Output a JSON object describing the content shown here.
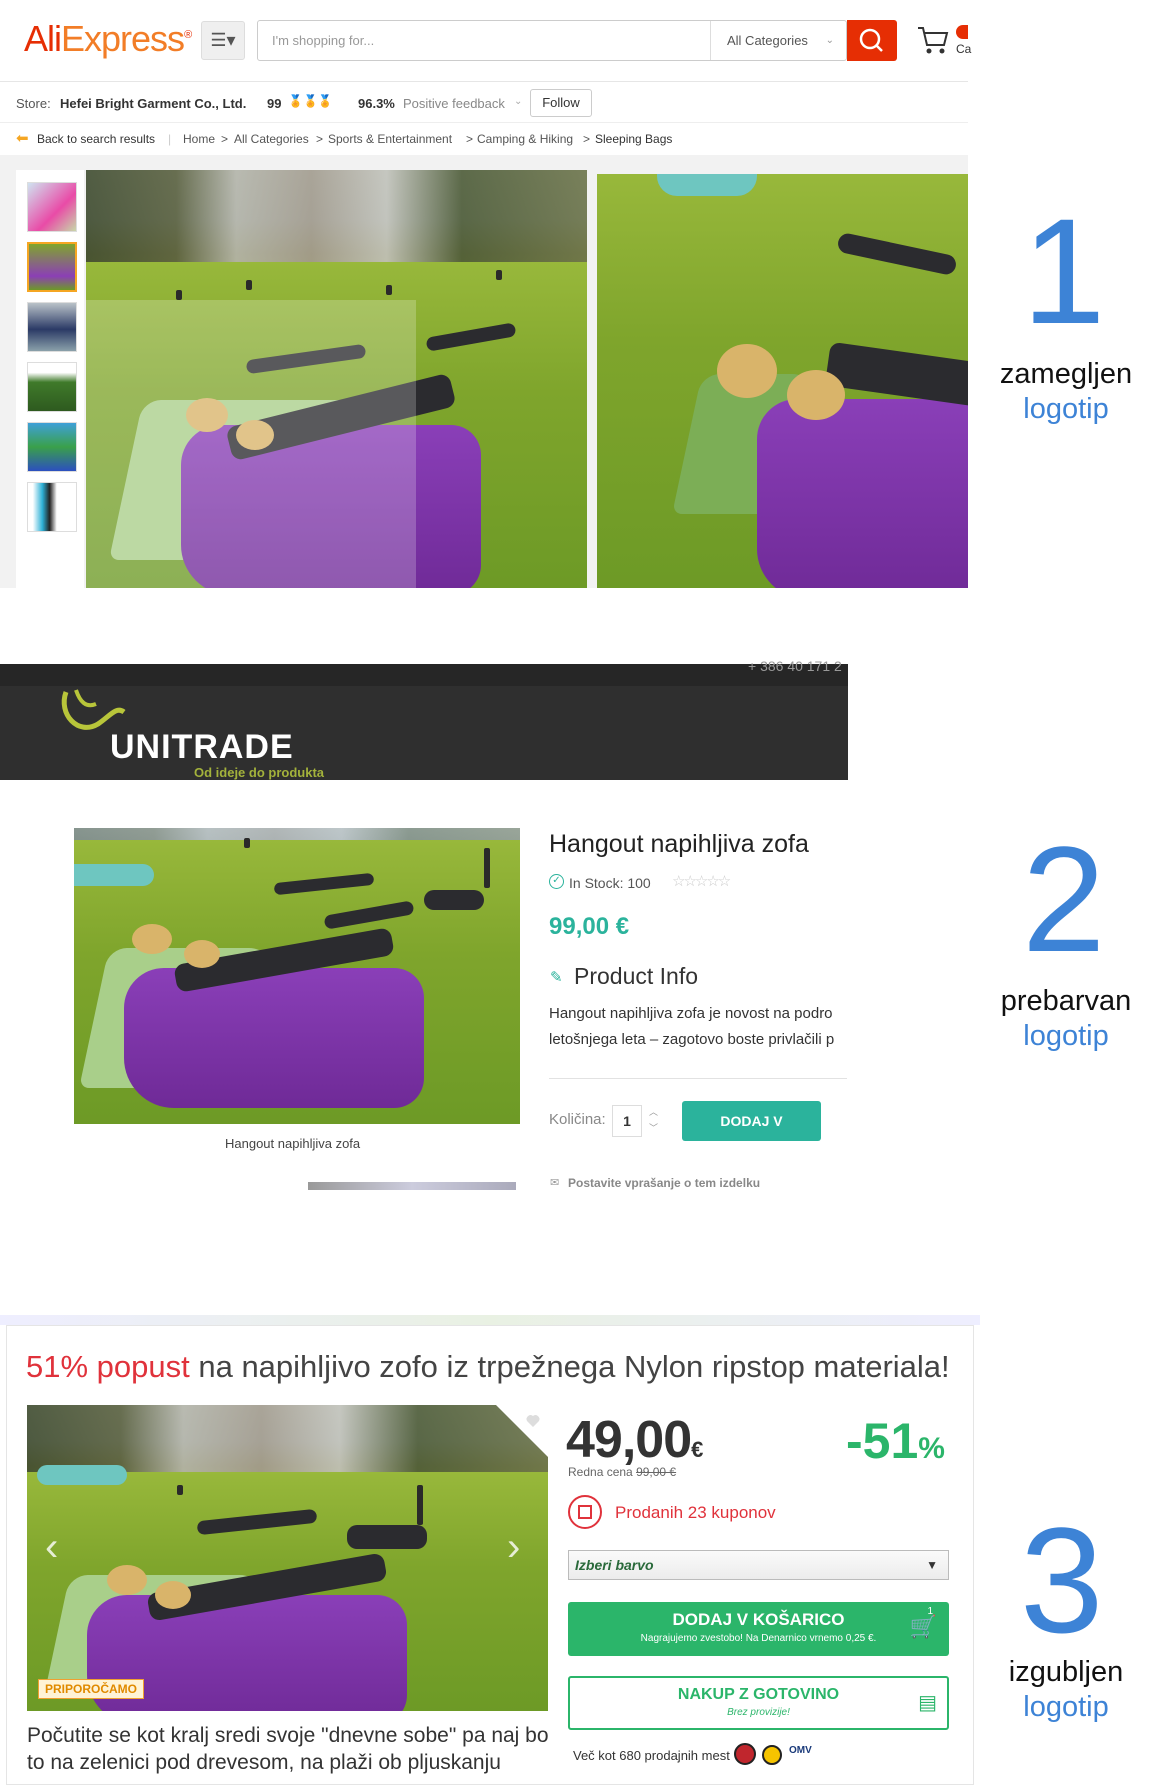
{
  "section1": {
    "logo": {
      "part1": "Ali",
      "part2": "Express",
      "tm": "®"
    },
    "menu_icon": "menu-icon",
    "search": {
      "placeholder": "I'm shopping for...",
      "category": "All Categories"
    },
    "cart_label": "Ca",
    "store": {
      "label": "Store:",
      "name": "Hefei Bright Garment Co., Ltd.",
      "score": "99",
      "feedback_pct": "96.3%",
      "feedback_label": "Positive feedback",
      "follow": "Follow"
    },
    "breadcrumb": {
      "back": "Back to search results",
      "items": [
        "Home",
        "All Categories",
        "Sports & Entertainment",
        "Camping & Hiking",
        "Sleeping Bags"
      ],
      "sep": ">"
    },
    "number": "1",
    "caption": {
      "line1": "zamegljen",
      "line2": "logotip"
    }
  },
  "section2": {
    "phone": "+ 386 40 171 2",
    "logo": "UNITRADE",
    "tagline": "Od ideje do produkta",
    "title": "Hangout napihljiva zofa",
    "stock": "In Stock: 100",
    "price": "99,00 €",
    "product_info": "Product Info",
    "desc_line1": "Hangout napihljiva zofa je novost na podro",
    "desc_line2": "letošnjega leta – zagotovo boste privlačili p",
    "qty_label": "Količina:",
    "qty_value": "1",
    "add_button": "DODAJ V KOŠARICO",
    "image_caption": "Hangout napihljiva zofa",
    "ask": "Postavite vprašanje o tem izdelku",
    "number": "2",
    "caption": {
      "line1": "prebarvan",
      "line2": "logotip"
    }
  },
  "section3": {
    "title_red": "51% popust",
    "title_rest": " na napihljivo zofo iz trpežnega Nylon ripstop materiala!",
    "price_main": "49,00",
    "price_currency": "€",
    "discount_main": "-51",
    "discount_pct": "%",
    "regular_label": "Redna cena",
    "regular_price": "99,00 €",
    "sold": "Prodanih 23 kuponov",
    "select_placeholder": "Izberi barvo",
    "add_line1": "DODAJ V KOŠARICO",
    "add_line2": "Nagrajujemo zvestobo! Na Denarnico vrnemo 0,25 €.",
    "cart_count": "1",
    "cash_line1": "NAKUP Z GOTOVINO",
    "cash_line2": "Brez provizije!",
    "recommend": "PRIPOROČAMO",
    "shops": "Več kot 680 prodajnih mest",
    "shops_brand": "OMV",
    "desc": "Počutite se kot kralj sredi svoje \"dnevne sobe\" pa naj bo to na zelenici pod drevesom, na plaži ob pljuskanju",
    "number": "3",
    "caption": {
      "line1": "izgubljen",
      "line2": "logotip"
    }
  },
  "colors": {
    "aliexpress_red": "#e62e04",
    "unitrade_green": "#2bb39c",
    "deal_green": "#2bb56a",
    "deal_red": "#e0323b",
    "annotation_blue": "#3d83d6"
  }
}
